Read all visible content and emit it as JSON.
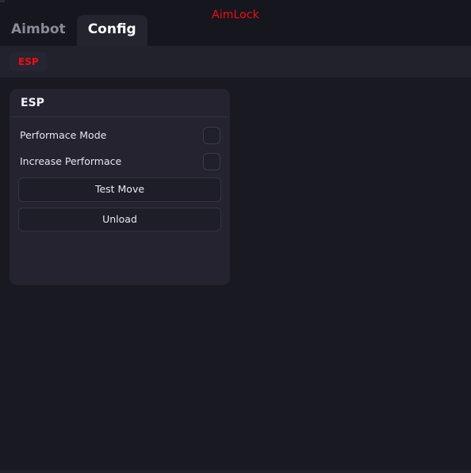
{
  "window": {
    "title": "AimLock",
    "title_color": "#f40c0c",
    "background_color": "#191922"
  },
  "header": {
    "tabs": [
      {
        "label": "Aimbot",
        "active": false
      },
      {
        "label": "Config",
        "active": true
      }
    ]
  },
  "subbar": {
    "tabs": [
      {
        "label": "ESP",
        "active": true,
        "color": "#f40c0c"
      }
    ]
  },
  "panel": {
    "title": "ESP",
    "toggles": [
      {
        "label": "Performace Mode",
        "checked": false
      },
      {
        "label": "Increase Performace",
        "checked": false
      }
    ],
    "buttons": [
      {
        "label": "Test Move"
      },
      {
        "label": "Unload"
      }
    ]
  }
}
